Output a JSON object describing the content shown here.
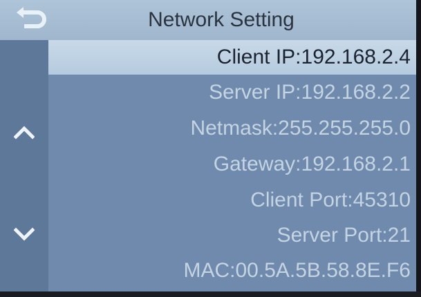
{
  "colors": {
    "header_bg": "#a9bfd4",
    "body_bg": "#6f8aac",
    "sidebar_bg": "#5e789a",
    "selected_bg": "#c2d4e5",
    "item_text": "#c5d4e3",
    "selected_text": "#1b2330"
  },
  "header": {
    "title": "Network Setting",
    "back_icon": "return-arrow-icon"
  },
  "sidebar": {
    "scroll_up_icon": "chevron-up-icon",
    "scroll_down_icon": "chevron-down-icon"
  },
  "settings": {
    "selected_index": 0,
    "items": [
      {
        "label": "Client IP:192.168.2.4"
      },
      {
        "label": "Server IP:192.168.2.2"
      },
      {
        "label": "Netmask:255.255.255.0"
      },
      {
        "label": "Gateway:192.168.2.1"
      },
      {
        "label": "Client Port:45310"
      },
      {
        "label": "Server Port:21"
      },
      {
        "label": "MAC:00.5A.5B.58.8E.F6"
      }
    ]
  }
}
